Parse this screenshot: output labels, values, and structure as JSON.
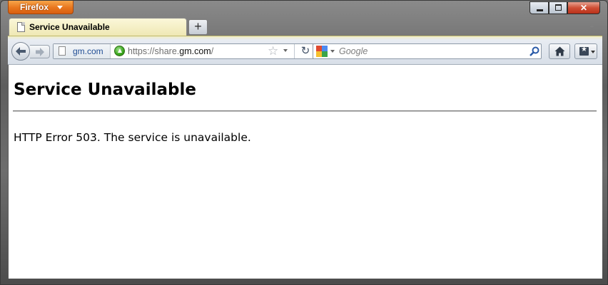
{
  "app": {
    "menu_button_label": "Firefox"
  },
  "tabs": [
    {
      "label": "Service Unavailable"
    }
  ],
  "new_tab_label": "+",
  "urlbar": {
    "identity_domain": "gm.com",
    "url_prefix": "https://share.",
    "url_host": "gm.com",
    "url_suffix": "/"
  },
  "searchbar": {
    "placeholder": "Google"
  },
  "page": {
    "heading": "Service Unavailable",
    "message": "HTTP Error 503. The service is unavailable."
  },
  "icons": {
    "back": "back-arrow-icon",
    "forward": "forward-arrow-icon",
    "star": "bookmark-star-icon",
    "reload": "reload-icon",
    "home": "home-icon",
    "bookmarks": "bookmarks-menu-icon"
  }
}
